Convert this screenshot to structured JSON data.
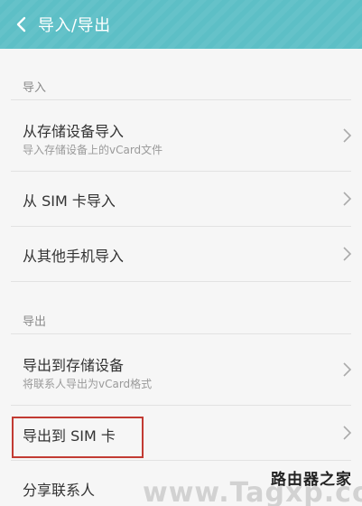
{
  "header": {
    "title": "导入/导出",
    "background": "#5dbfc6",
    "back_icon": "chevron-left-icon"
  },
  "sections": {
    "import_label": "导入",
    "export_label": "导出"
  },
  "rows": {
    "import_storage": {
      "title": "从存储设备导入",
      "subtitle": "导入存储设备上的vCard文件"
    },
    "import_sim": {
      "title": "从 SIM 卡导入"
    },
    "import_other_phone": {
      "title": "从其他手机导入"
    },
    "export_storage": {
      "title": "导出到存储设备",
      "subtitle": "将联系人导出为vCard格式"
    },
    "export_sim": {
      "title": "导出到 SIM 卡",
      "highlight_color": "#c23b33"
    },
    "share_contacts": {
      "title": "分享联系人"
    }
  },
  "watermark": {
    "large": "www.Tagxp.com",
    "top": "路由器之家"
  }
}
